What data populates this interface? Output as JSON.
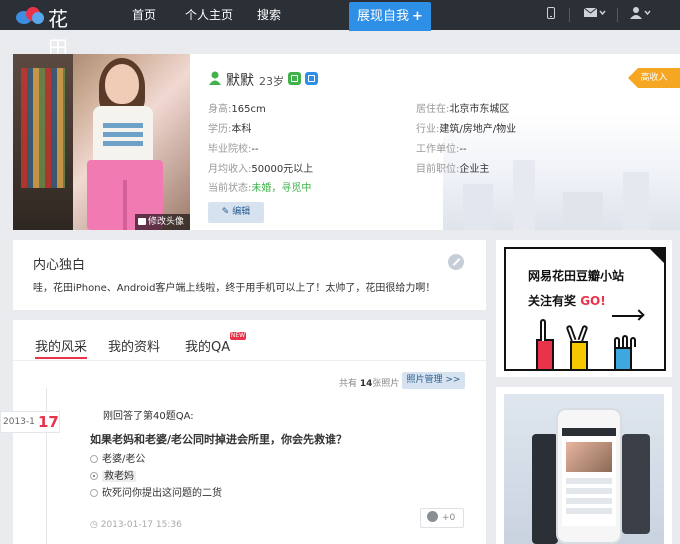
{
  "topbar": {
    "logo_text": "花田",
    "nav": [
      "首页",
      "个人主页",
      "搜索"
    ],
    "show_btn": "展现自我",
    "show_btn_plus": "+",
    "icons": [
      "phone-icon",
      "mail-icon",
      "user-icon"
    ]
  },
  "profile": {
    "name": "默默",
    "age": "23岁",
    "change_avatar": "修改头像",
    "vip_tag": "高收入",
    "edit_btn": "编辑",
    "left_rows": [
      {
        "label": "身高:",
        "value": "165cm"
      },
      {
        "label": "学历:",
        "value": "本科"
      },
      {
        "label": "毕业院校:",
        "value": "--"
      },
      {
        "label": "月均收入:",
        "value": "50000元以上"
      },
      {
        "label": "当前状态:",
        "value": "未婚，寻觅中"
      }
    ],
    "right_rows": [
      {
        "label": "居住在:",
        "value": "北京市东城区"
      },
      {
        "label": "行业:",
        "value": "建筑/房地产/物业"
      },
      {
        "label": "工作单位:",
        "value": "--"
      },
      {
        "label": "目前职位:",
        "value": "企业主"
      }
    ],
    "colors": {
      "accent_green": "#3fb24a",
      "accent_blue": "#2e8fe6",
      "vip": "#f5a623"
    }
  },
  "monologue": {
    "title": "内心独白",
    "text": "哇，花田iPhone、Android客户端上线啦，终于用手机可以上了！太帅了，花田很给力啊！"
  },
  "tabs": {
    "style": "我的风采",
    "info": "我的资料",
    "qa": "我的QA",
    "new_badge": "NEW"
  },
  "photos": {
    "count_prefix": "共有",
    "count": "14",
    "count_suffix": "张照片",
    "manage_btn": "照片管理 >>"
  },
  "timeline": {
    "year_month": "2013-1",
    "day": "17",
    "answered": "刚回答了第40题QA:",
    "question": "如果老妈和老婆/老公同时掉进会所里，你会先救谁？",
    "options": [
      "老婆/老公",
      "救老妈",
      "砍死问你提出这问题的二货"
    ],
    "selected_index": 1,
    "time": "2013-01-17 15:36",
    "likes": "+0"
  },
  "ad": {
    "line1": "网易花田豆瓣小站",
    "line2_main": "关注有奖 ",
    "line2_go": "GO!"
  }
}
